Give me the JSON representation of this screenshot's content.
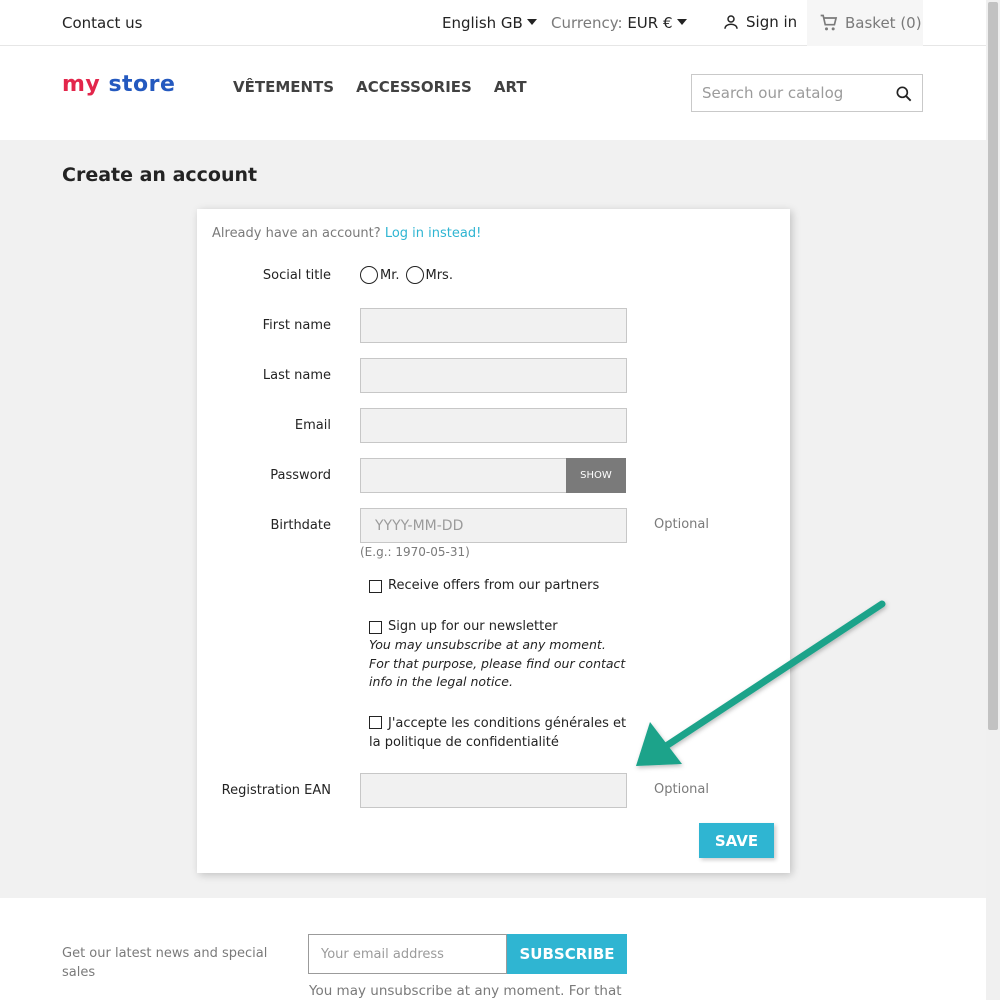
{
  "topbar": {
    "contact": "Contact us",
    "language": "English GB",
    "currency_label": "Currency:",
    "currency_value": "EUR €",
    "signin": "Sign in",
    "basket": "Basket (0)"
  },
  "header": {
    "logo_my": "my",
    "logo_store": "store",
    "nav": [
      "VÊTEMENTS",
      "ACCESSORIES",
      "ART"
    ],
    "search_placeholder": "Search our catalog"
  },
  "page": {
    "title": "Create an account"
  },
  "form": {
    "already": "Already have an account?",
    "login_link": "Log in instead!",
    "social_title": "Social title",
    "mr": "Mr.",
    "mrs": "Mrs.",
    "first_name": "First name",
    "last_name": "Last name",
    "email": "Email",
    "password": "Password",
    "show": "SHOW",
    "birthdate": "Birthdate",
    "birthdate_placeholder": "YYYY-MM-DD",
    "birthdate_hint": "(E.g.: 1970-05-31)",
    "optional": "Optional",
    "offers": "Receive offers from our partners",
    "newsletter": "Sign up for our newsletter",
    "newsletter_note": "You may unsubscribe at any moment. For that purpose, please find our contact info in the legal notice.",
    "terms": "J'accepte les conditions générales et la politique de confidentialité",
    "ean": "Registration EAN",
    "save": "SAVE"
  },
  "footer": {
    "news": "Get our latest news and special sales",
    "email_placeholder": "Your email address",
    "subscribe": "SUBSCRIBE",
    "unsub": "You may unsubscribe at any moment. For that"
  },
  "colors": {
    "accent": "#2fb5d2",
    "arrow": "#1aa38a"
  }
}
